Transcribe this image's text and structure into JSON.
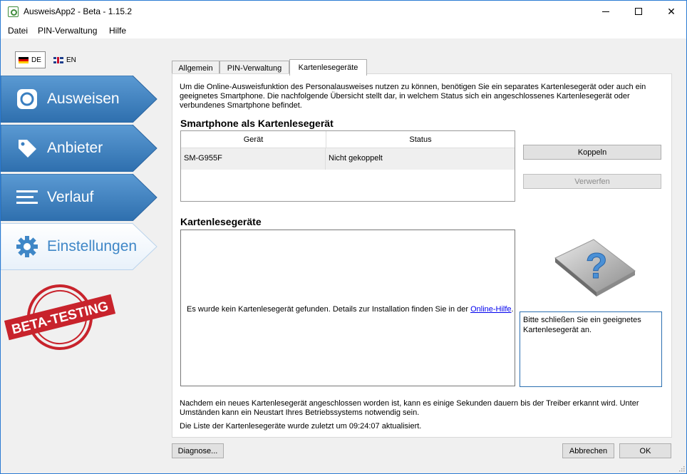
{
  "window": {
    "title": "AusweisApp2 - Beta - 1.15.2"
  },
  "menu": {
    "items": [
      "Datei",
      "PIN-Verwaltung",
      "Hilfe"
    ]
  },
  "language": {
    "de": "DE",
    "en": "EN"
  },
  "nav": {
    "items": [
      {
        "label": "Ausweisen",
        "icon": "id-card-icon"
      },
      {
        "label": "Anbieter",
        "icon": "tag-icon"
      },
      {
        "label": "Verlauf",
        "icon": "list-icon"
      },
      {
        "label": "Einstellungen",
        "icon": "gear-icon"
      }
    ],
    "active": "Einstellungen"
  },
  "beta_stamp": "BETA-TESTING",
  "tabs": [
    "Allgemein",
    "PIN-Verwaltung",
    "Kartenlesegeräte"
  ],
  "active_tab": "Kartenlesegeräte",
  "intro": "Um die Online-Ausweisfunktion des Personalausweises nutzen zu können, benötigen Sie ein separates Kartenlesegerät oder auch ein geeignetes Smartphone. Die nachfolgende Übersicht stellt dar, in welchem Status sich ein angeschlossenes Kartenlesegerät oder verbundenes Smartphone befindet.",
  "smartphone": {
    "heading": "Smartphone als Kartenlesegerät",
    "columns": [
      "Gerät",
      "Status"
    ],
    "rows": [
      {
        "device": "SM-G955F",
        "status": "Nicht gekoppelt"
      }
    ],
    "buttons": {
      "pair": "Koppeln",
      "discard": "Verwerfen"
    }
  },
  "readers": {
    "heading": "Kartenlesegeräte",
    "empty_text": "Es wurde kein Kartenlesegerät gefunden. Details zur Installation finden Sie in der ",
    "link_text": "Online-Hilfe",
    "link_suffix": ".",
    "hint": "Bitte schließen Sie ein geeignetes Kartenlesegerät an."
  },
  "notes": {
    "driver": "Nachdem ein neues Kartenlesegerät angeschlossen worden ist, kann es einige Sekunden dauern bis der Treiber erkannt wird. Unter Umständen kann ein Neustart Ihres Betriebssystems notwendig sein.",
    "updated": "Die Liste der Kartenlesegeräte wurde zuletzt um 09:24:07 aktualisiert."
  },
  "footer": {
    "diagnose": "Diagnose...",
    "cancel": "Abbrechen",
    "ok": "OK"
  },
  "colors": {
    "nav_blue": "#3a7fc1",
    "nav_blue_light": "#5a9bd6",
    "accent_border": "#2b7bd3"
  }
}
